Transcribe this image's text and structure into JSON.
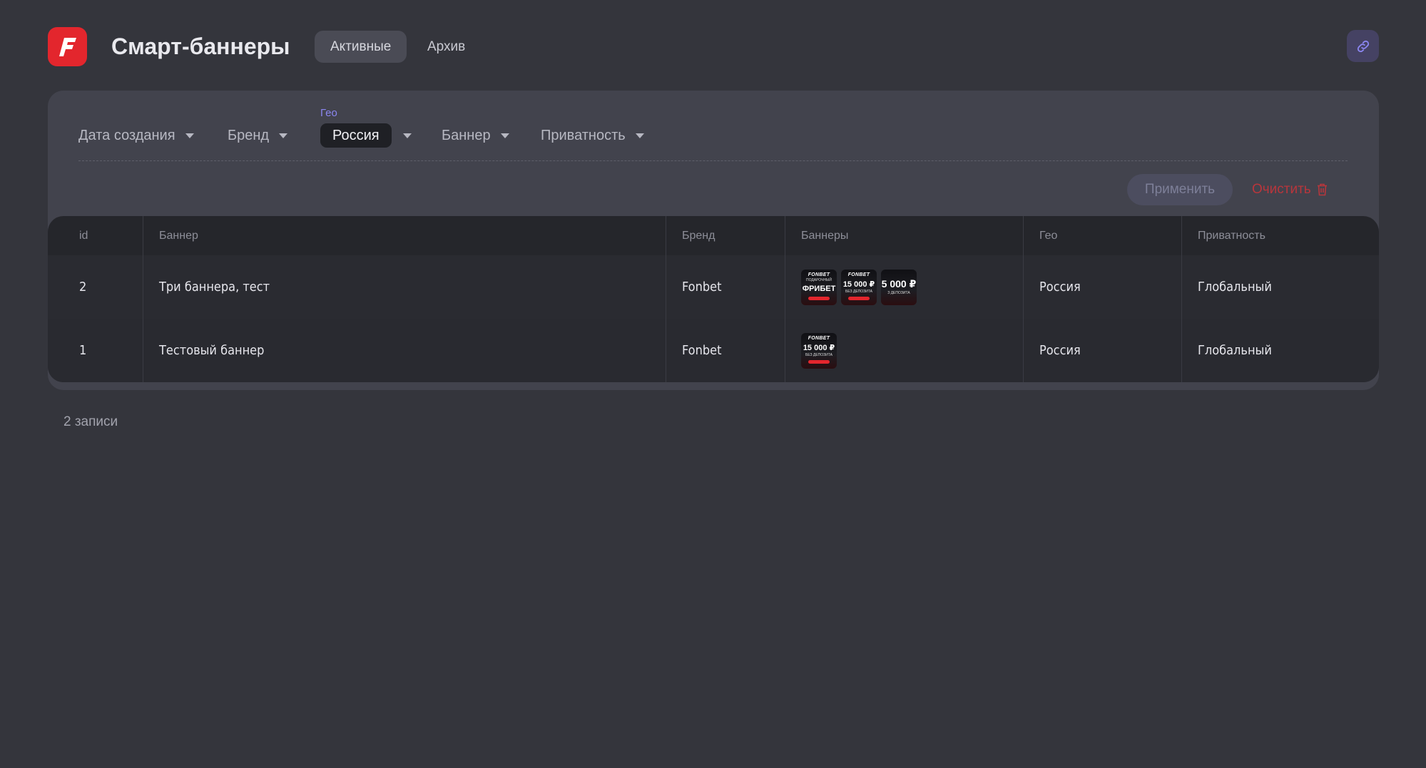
{
  "header": {
    "logo_letter": "F",
    "title": "Смарт-баннеры",
    "tabs": [
      {
        "label": "Активные",
        "active": true
      },
      {
        "label": "Архив",
        "active": false
      }
    ],
    "link_icon": "link-icon"
  },
  "filters": {
    "date_label": "Дата создания",
    "brand_label": "Бренд",
    "geo_caption": "Гео",
    "geo_value": "Россия",
    "banner_label": "Баннер",
    "privacy_label": "Приватность",
    "apply_label": "Применить",
    "clear_label": "Очистить"
  },
  "table": {
    "columns": [
      "id",
      "Баннер",
      "Бренд",
      "Баннеры",
      "Гео",
      "Приватность"
    ],
    "rows": [
      {
        "id": "2",
        "name": "Три баннера, тест",
        "brand": "Fonbet",
        "banners": [
          {
            "brand": "FONBET",
            "big": "ФРИБЕТ",
            "small": "ПОДАРОЧНЫЙ"
          },
          {
            "brand": "FONBET",
            "big": "15 000 ₽",
            "small": "БЕЗ ДЕПОЗИТА"
          },
          {
            "brand": "",
            "big": "5 000 ₽",
            "small": "З ДЕПОЗИТА"
          }
        ],
        "geo": "Россия",
        "privacy": "Глобальный"
      },
      {
        "id": "1",
        "name": "Тестовый баннер",
        "brand": "Fonbet",
        "banners": [
          {
            "brand": "FONBET",
            "big": "15 000 ₽",
            "small": "БЕЗ ДЕПОЗИТА"
          }
        ],
        "geo": "Россия",
        "privacy": "Глобальный"
      }
    ]
  },
  "footer": {
    "count_text": "2 записи"
  },
  "colors": {
    "background": "#34353c",
    "panel": "#42434d",
    "accent_red": "#e3262d",
    "accent_violet": "#8b86f0"
  }
}
